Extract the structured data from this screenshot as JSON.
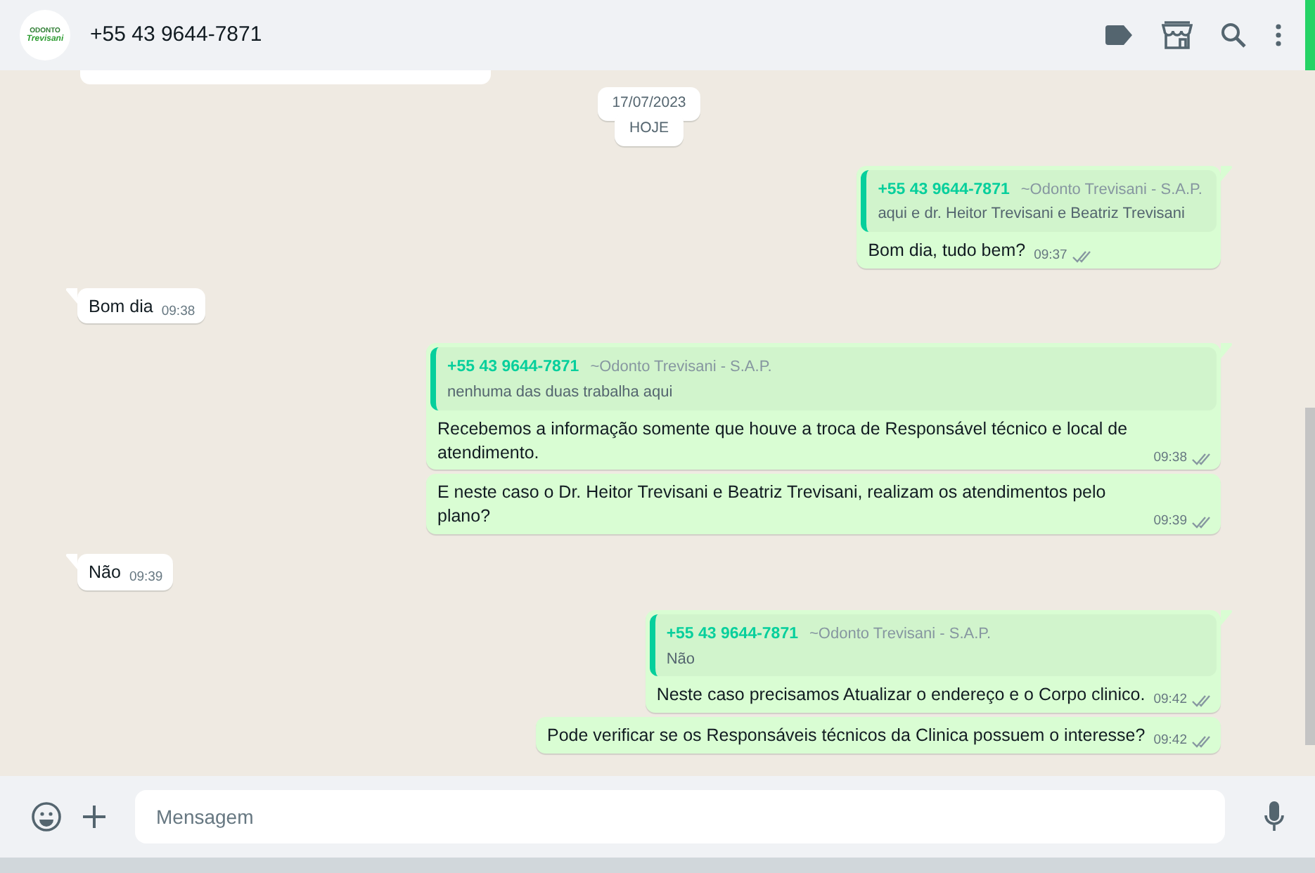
{
  "header": {
    "title": "+55 43 9644-7871",
    "avatar": {
      "line_1": "ODONTO",
      "line_2": "Trevisani"
    }
  },
  "messages": [
    {
      "kind": "cut"
    },
    {
      "kind": "date",
      "text": "17/07/2023"
    },
    {
      "kind": "date",
      "text": "HOJE"
    },
    {
      "kind": "out",
      "tail": true,
      "quote": {
        "phone": "+55 43 9644-7871",
        "sender": "~Odonto Trevisani - S.A.P.",
        "text": "aqui e dr. Heitor Trevisani e Beatriz Trevisani"
      },
      "text": "Bom dia, tudo bem?",
      "time": "09:37",
      "delivered": true
    },
    {
      "kind": "in",
      "tail": true,
      "text": "Bom dia",
      "time": "09:38"
    },
    {
      "kind": "out",
      "tail": true,
      "quote": {
        "phone": "+55 43 9644-7871",
        "sender": "~Odonto Trevisani - S.A.P.",
        "text": "nenhuma das duas trabalha aqui"
      },
      "text": "Recebemos a informação somente que houve a troca de Responsável técnico e local de atendimento.",
      "time": "09:38",
      "delivered": true
    },
    {
      "kind": "out",
      "tail": false,
      "text": "E neste caso o Dr. Heitor Trevisani e Beatriz Trevisani, realizam os atendimentos pelo plano?",
      "time": "09:39",
      "delivered": true
    },
    {
      "kind": "in",
      "tail": true,
      "text": "Não",
      "time": "09:39"
    },
    {
      "kind": "out",
      "tail": true,
      "quote": {
        "phone": "+55 43 9644-7871",
        "sender": "~Odonto Trevisani - S.A.P.",
        "text": "Não"
      },
      "text": "Neste caso precisamos Atualizar o endereço e o Corpo clinico.",
      "time": "09:42",
      "delivered": true
    },
    {
      "kind": "out",
      "tail": false,
      "text": "Pode verificar se os Responsáveis técnicos da Clinica possuem o interesse?",
      "time": "09:42",
      "delivered": true
    }
  ],
  "composer": {
    "placeholder": "Mensagem"
  }
}
